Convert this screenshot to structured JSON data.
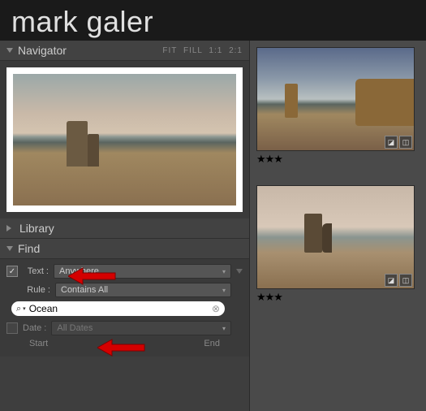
{
  "branding": {
    "first": "mark",
    "last": "galer"
  },
  "navigator": {
    "title": "Navigator",
    "zoom": {
      "fit": "FIT",
      "fill": "FILL",
      "one": "1:1",
      "two": "2:1"
    }
  },
  "library": {
    "title": "Library"
  },
  "find": {
    "title": "Find",
    "text_checked": "✓",
    "text_label": "Text :",
    "text_scope": "Anywhere",
    "rule_label": "Rule :",
    "rule_value": "Contains All",
    "search_value": "Ocean",
    "date_label": "Date :",
    "date_value": "All Dates",
    "start": "Start",
    "end": "End"
  },
  "thumbs": [
    {
      "stars": "★★★"
    },
    {
      "stars": "★★★"
    }
  ],
  "icons": {
    "crop": "◪",
    "adjust": "◫"
  }
}
